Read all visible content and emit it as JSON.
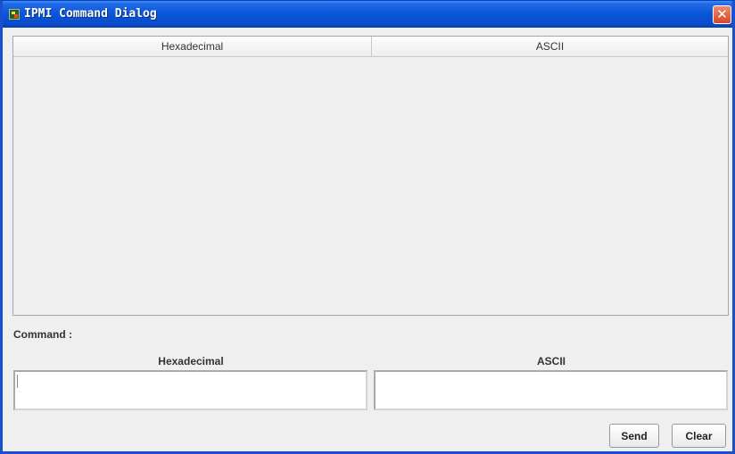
{
  "window": {
    "title": "IPMI Command Dialog",
    "close_glyph": "✕",
    "icon": "app-icon",
    "colors": {
      "titlebar": "#0a55d8",
      "body": "#efefef",
      "close": "#d4482a"
    }
  },
  "response_table": {
    "columns": [
      "Hexadecimal",
      "ASCII"
    ],
    "rows": []
  },
  "command": {
    "label": "Command :",
    "hex_label": "Hexadecimal",
    "ascii_label": "ASCII",
    "hex_value": "",
    "ascii_value": ""
  },
  "buttons": {
    "send": "Send",
    "clear": "Clear"
  }
}
